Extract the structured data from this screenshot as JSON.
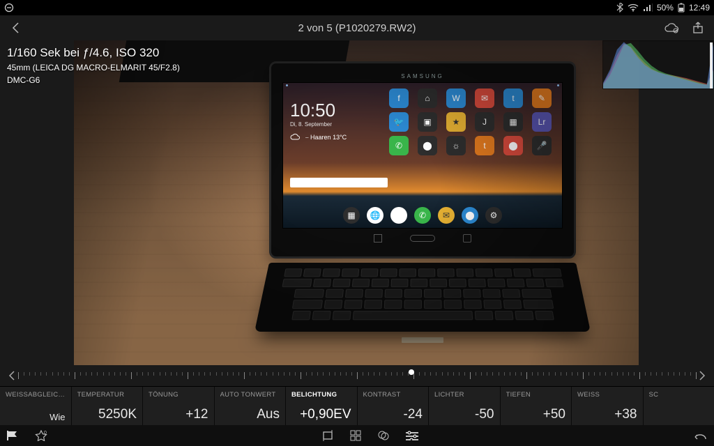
{
  "statusbar": {
    "battery_pct": "50%",
    "clock": "12:49"
  },
  "topbar": {
    "title": "2 von 5 (P1020279.RW2)"
  },
  "metadata": {
    "exposure": "1/160 Sek bei ƒ/4.6, ISO 320",
    "lens": "45mm (LEICA DG MACRO-ELMARIT 45/F2.8)",
    "camera": "DMC-G6"
  },
  "tablet": {
    "brand": "SAMSUNG",
    "clock": "10:50",
    "date": "Di, 8. September",
    "weather_loc": "Haaren",
    "weather_temp": "13°C"
  },
  "params": [
    {
      "id": "wb",
      "label": "WEISSABGLEICH…",
      "value": "Wie",
      "active": false
    },
    {
      "id": "temp",
      "label": "TEMPERATUR",
      "value": "5250K",
      "active": false
    },
    {
      "id": "tint",
      "label": "TÖNUNG",
      "value": "+12",
      "active": false
    },
    {
      "id": "autotone",
      "label": "AUTO TONWERT",
      "value": "Aus",
      "active": false
    },
    {
      "id": "exposure",
      "label": "BELICHTUNG",
      "value": "+0,90EV",
      "active": true
    },
    {
      "id": "contrast",
      "label": "KONTRAST",
      "value": "-24",
      "active": false
    },
    {
      "id": "high",
      "label": "LICHTER",
      "value": "-50",
      "active": false
    },
    {
      "id": "shad",
      "label": "TIEFEN",
      "value": "+50",
      "active": false
    },
    {
      "id": "white",
      "label": "WEISS",
      "value": "+38",
      "active": false
    },
    {
      "id": "black",
      "label": "SC",
      "value": "",
      "active": false
    }
  ],
  "ruler": {
    "marker_pct": 58
  },
  "chart_data": {
    "type": "area",
    "title": "RGB Histogram",
    "xlabel": "",
    "ylabel": "",
    "x": [
      0,
      16,
      32,
      48,
      64,
      80,
      96,
      112,
      128,
      144,
      160,
      176,
      192,
      208,
      224,
      240,
      255
    ],
    "series": [
      {
        "name": "R",
        "color": "#e05a5a",
        "values": [
          10,
          35,
          70,
          95,
          88,
          70,
          55,
          42,
          35,
          30,
          28,
          25,
          22,
          18,
          14,
          10,
          40
        ]
      },
      {
        "name": "G",
        "color": "#5acc6a",
        "values": [
          8,
          28,
          60,
          92,
          96,
          80,
          62,
          48,
          38,
          32,
          28,
          24,
          20,
          16,
          12,
          8,
          38
        ]
      },
      {
        "name": "B",
        "color": "#5a8ae0",
        "values": [
          12,
          40,
          82,
          98,
          86,
          66,
          50,
          40,
          34,
          30,
          26,
          22,
          18,
          14,
          10,
          8,
          95
        ]
      }
    ],
    "xlim": [
      0,
      255
    ],
    "ylim": [
      0,
      100
    ]
  }
}
